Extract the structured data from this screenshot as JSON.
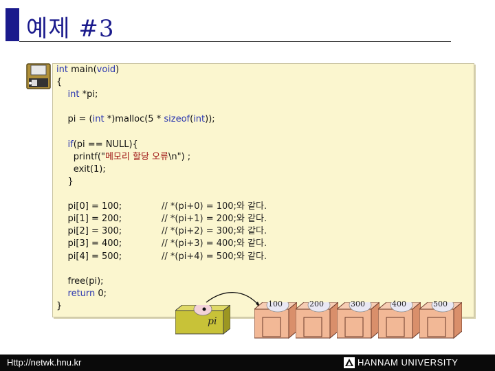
{
  "slide": {
    "title": "예제 #3",
    "code_lines": [
      [
        {
          "t": "int",
          "c": "kw"
        },
        {
          "t": " main(",
          "c": ""
        },
        {
          "t": "void",
          "c": "kw"
        },
        {
          "t": ")",
          "c": ""
        }
      ],
      [
        {
          "t": "{",
          "c": ""
        }
      ],
      [
        {
          "t": "    ",
          "c": ""
        },
        {
          "t": "int",
          "c": "kw"
        },
        {
          "t": " *pi;",
          "c": ""
        }
      ],
      [],
      [
        {
          "t": "    pi = (",
          "c": ""
        },
        {
          "t": "int",
          "c": "kw"
        },
        {
          "t": " *)malloc(5 * ",
          "c": ""
        },
        {
          "t": "sizeof",
          "c": "kw"
        },
        {
          "t": "(",
          "c": ""
        },
        {
          "t": "int",
          "c": "kw"
        },
        {
          "t": "));",
          "c": ""
        }
      ],
      [],
      [
        {
          "t": "    ",
          "c": ""
        },
        {
          "t": "if",
          "c": "kw"
        },
        {
          "t": "(pi == NULL){",
          "c": ""
        }
      ],
      [
        {
          "t": "      printf(\"",
          "c": ""
        },
        {
          "t": "메모리 할당 오류",
          "c": "str"
        },
        {
          "t": "\\n\") ;",
          "c": ""
        }
      ],
      [
        {
          "t": "      exit(1);",
          "c": ""
        }
      ],
      [
        {
          "t": "    }",
          "c": ""
        }
      ],
      [],
      [
        {
          "t": "    pi[0] = 100;              ",
          "c": ""
        },
        {
          "t": "// *(pi+0) = 100;와 같다.",
          "c": "cm"
        }
      ],
      [
        {
          "t": "    pi[1] = 200;              ",
          "c": ""
        },
        {
          "t": "// *(pi+1) = 200;와 같다.",
          "c": "cm"
        }
      ],
      [
        {
          "t": "    pi[2] = 300;              ",
          "c": ""
        },
        {
          "t": "// *(pi+2) = 300;와 같다.",
          "c": "cm"
        }
      ],
      [
        {
          "t": "    pi[3] = 400;              ",
          "c": ""
        },
        {
          "t": "// *(pi+3) = 400;와 같다.",
          "c": "cm"
        }
      ],
      [
        {
          "t": "    pi[4] = 500;              ",
          "c": ""
        },
        {
          "t": "// *(pi+4) = 500;와 같다.",
          "c": "cm"
        }
      ],
      [],
      [
        {
          "t": "    free(pi);",
          "c": ""
        }
      ],
      [
        {
          "t": "    ",
          "c": ""
        },
        {
          "t": "return",
          "c": "kw"
        },
        {
          "t": " 0;",
          "c": ""
        }
      ],
      [
        {
          "t": "}",
          "c": ""
        }
      ]
    ],
    "pointer_label": "pi",
    "memory_values": [
      "100",
      "200",
      "300",
      "400",
      "500"
    ]
  },
  "footer": {
    "url": "Http://netwk.hnu.kr",
    "university": "HANNAM  UNIVERSITY"
  },
  "colors": {
    "title": "#1a1a8c",
    "code_bg": "#fbf6cf",
    "keyword": "#2a36b0",
    "string": "#a01818",
    "footer_bg": "#0a0a0a",
    "box_fill": "#f2b896",
    "pi_fill": "#c8c238"
  }
}
